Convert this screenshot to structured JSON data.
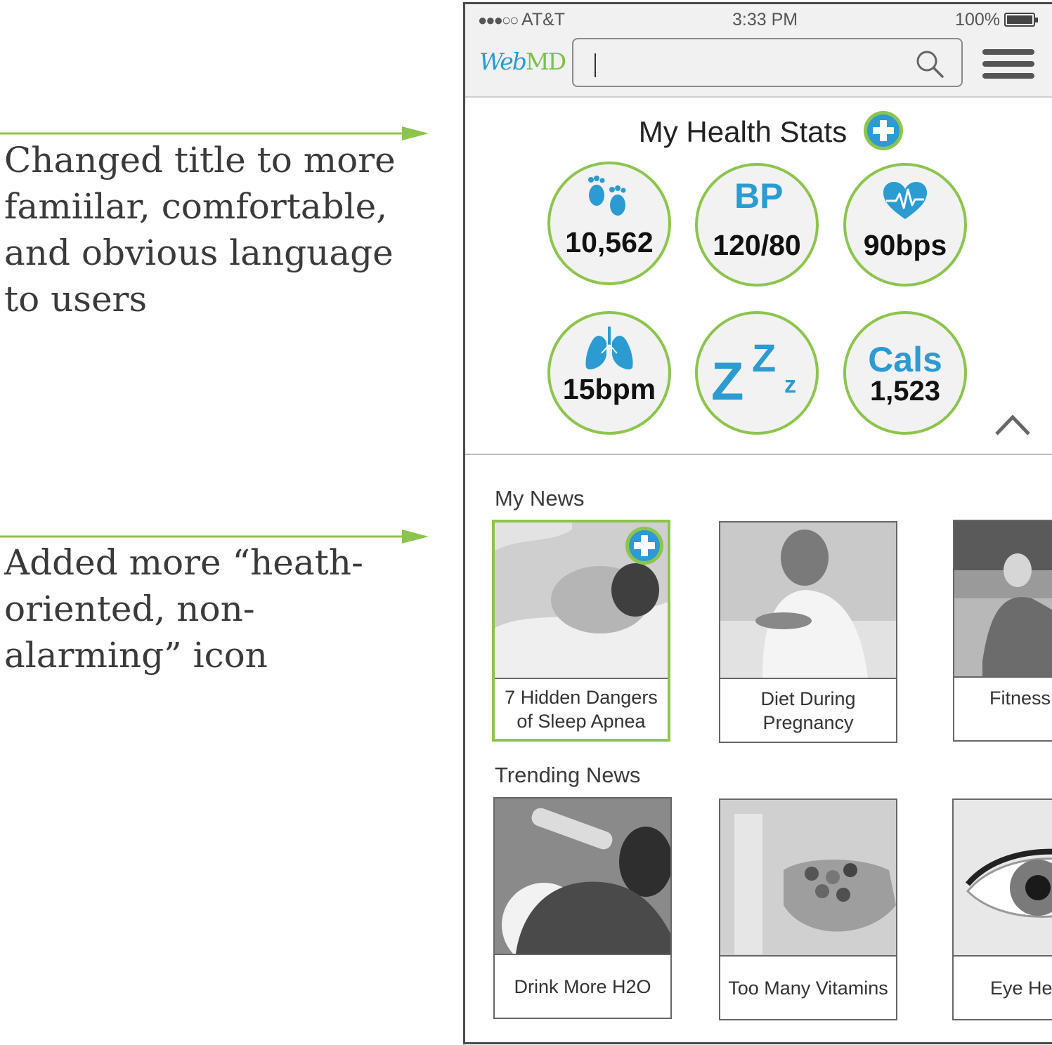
{
  "annotations": [
    {
      "text": "Changed title to more\nfamiilar, comfortable,\nand obvious language\nto users"
    },
    {
      "text": "Added more “heath-\noriented, non-\nalarming” icon"
    }
  ],
  "status_bar": {
    "signal": "●●●○○",
    "carrier": "AT&T",
    "time": "3:33 PM",
    "battery": "100%"
  },
  "header": {
    "logo": {
      "web": "Web",
      "md": "MD"
    },
    "search": {
      "value": "",
      "placeholder": ""
    }
  },
  "health_stats": {
    "title": "My Health Stats",
    "items": [
      {
        "icon": "footprints-icon",
        "value": "10,562"
      },
      {
        "icon": "blood-pressure-icon",
        "icon_text": "BP",
        "value": "120/80"
      },
      {
        "icon": "heart-rate-icon",
        "value": "90bps"
      },
      {
        "icon": "lungs-icon",
        "value": "15bpm"
      },
      {
        "icon": "sleep-icon",
        "icon_text": "Z Z z"
      },
      {
        "icon": "calories-icon",
        "icon_text": "Cals",
        "value": "1,523"
      }
    ]
  },
  "my_news": {
    "title": "My News",
    "items": [
      {
        "label": "7 Hidden Dangers of Sleep Apnea",
        "image": "man-sleeping-photo",
        "selected": true
      },
      {
        "label": "Diet During Pregnancy",
        "image": "pregnant-woman-eating-photo"
      },
      {
        "label": "Fitness",
        "image": "man-stretching-photo"
      }
    ]
  },
  "trending_news": {
    "title": "Trending News",
    "items": [
      {
        "label": "Drink More H2O",
        "image": "woman-drinking-water-photo"
      },
      {
        "label": "Too Many Vitamins",
        "image": "hand-with-pills-photo"
      },
      {
        "label": "Eye He",
        "image": "eye-closeup-photo"
      }
    ]
  },
  "colors": {
    "accent_green": "#8dc44e",
    "accent_blue": "#2b9bd1",
    "logo_green": "#7cc04b"
  }
}
